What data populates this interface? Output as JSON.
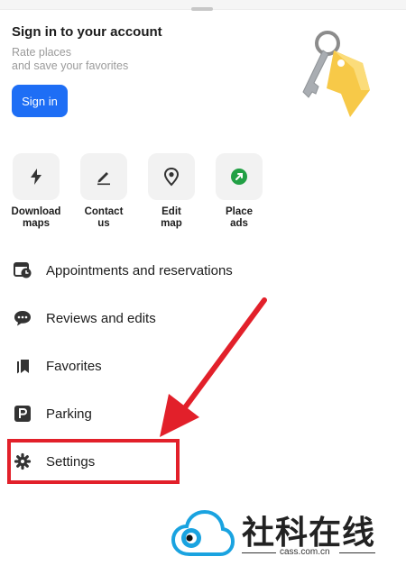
{
  "header": {
    "title": "Sign in to your account",
    "subtitle_line1": "Rate places",
    "subtitle_line2": "and save your favorites",
    "signin_label": "Sign in"
  },
  "quick_actions": [
    {
      "label": "Download\nmaps",
      "icon": "lightning-icon"
    },
    {
      "label": "Contact\nus",
      "icon": "pencil-icon"
    },
    {
      "label": "Edit\nmap",
      "icon": "map-pin-icon"
    },
    {
      "label": "Place\nads",
      "icon": "green-arrow-icon"
    }
  ],
  "menu": [
    {
      "label": "Appointments and reservations",
      "icon": "calendar-clock-icon"
    },
    {
      "label": "Reviews and edits",
      "icon": "chat-bubble-icon"
    },
    {
      "label": "Favorites",
      "icon": "bookmark-icon"
    },
    {
      "label": "Parking",
      "icon": "parking-icon"
    },
    {
      "label": "Settings",
      "icon": "gear-icon"
    }
  ],
  "annotation": {
    "color": "#e2202a",
    "target": "Settings"
  },
  "watermark": {
    "name": "社科在线",
    "url": "cass.com.cn"
  },
  "colors": {
    "accent": "#1e6ef5",
    "green": "#22a045",
    "tile_bg": "#f2f2f2"
  }
}
